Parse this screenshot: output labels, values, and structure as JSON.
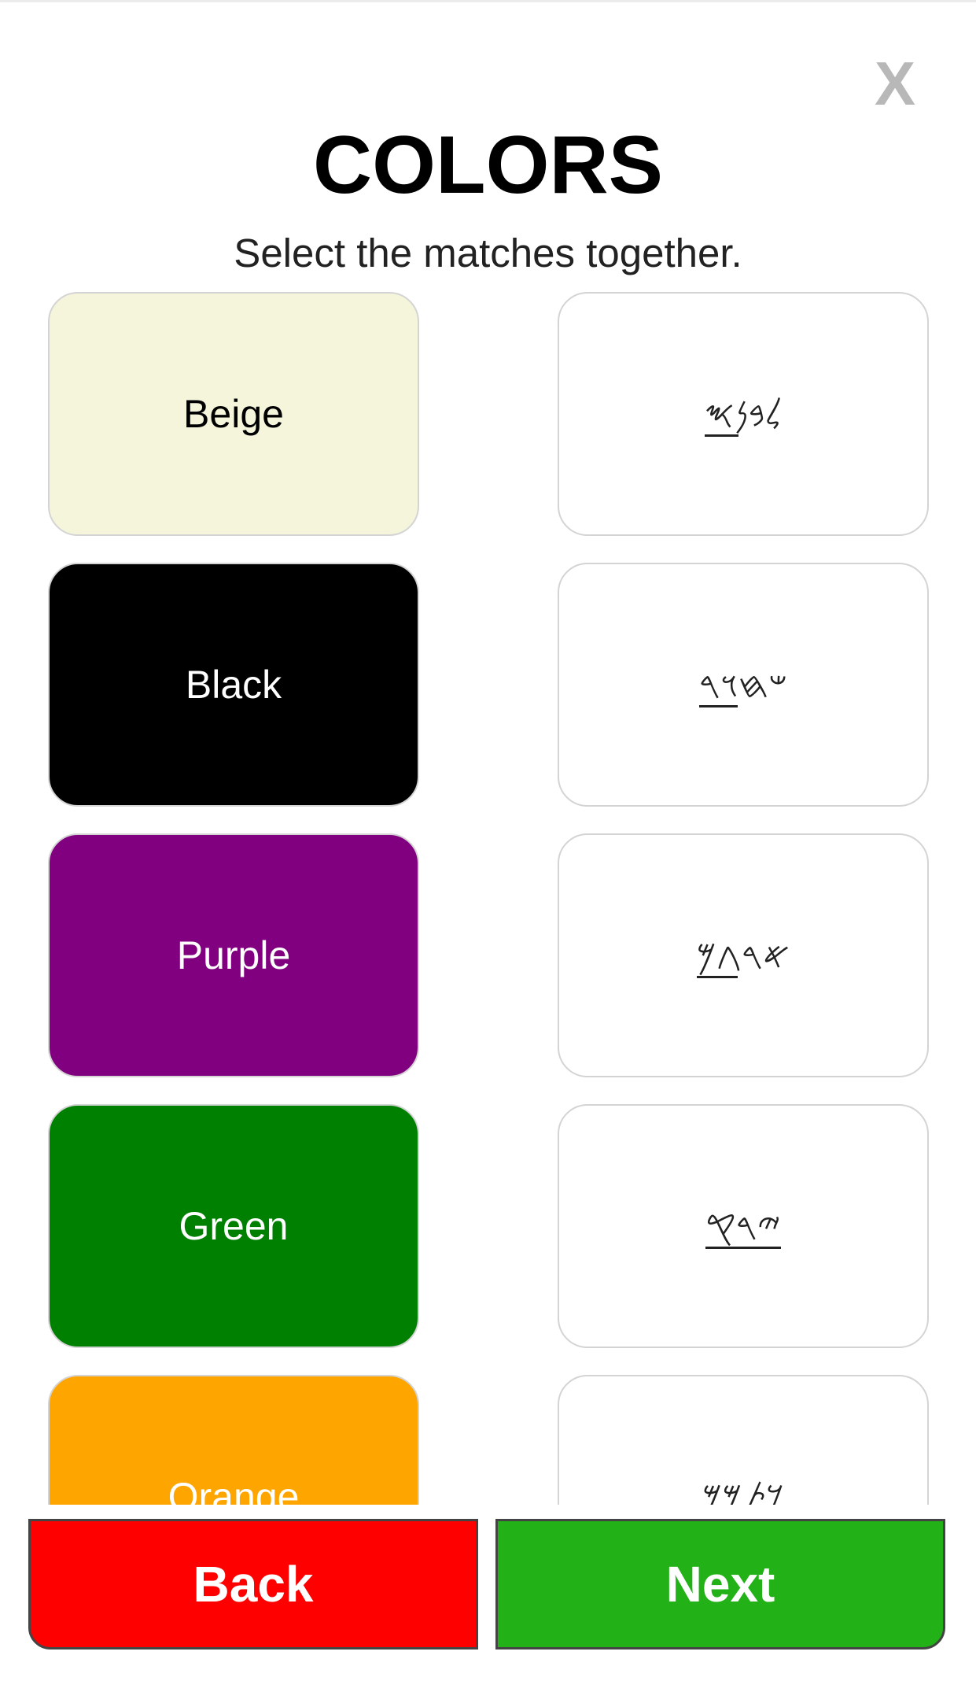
{
  "header": {
    "close_label": "X",
    "title": "COLORS",
    "subtitle": "Select the matches together."
  },
  "colors": [
    {
      "label": "Beige",
      "bg": "#F5F5DC",
      "text_color": "#000000"
    },
    {
      "label": "Black",
      "bg": "#000000",
      "text_color": "#FFFFFF"
    },
    {
      "label": "Purple",
      "bg": "#800080",
      "text_color": "#FFFFFF"
    },
    {
      "label": "Green",
      "bg": "#008000",
      "text_color": "#FFFFFF"
    },
    {
      "label": "Orange",
      "bg": "#FFA500",
      "text_color": "#FFFFFF"
    }
  ],
  "matches": [
    {
      "label": "𐤋𐤁𐤍𐤎"
    },
    {
      "label": "𐤔𐤇𐤅𐤓"
    },
    {
      "label": "𐤀𐤓𐤂𐤌"
    },
    {
      "label": "𐤉𐤓𐤒"
    },
    {
      "label": "𐤊𐤕𐤌𐤌"
    }
  ],
  "footer": {
    "back_label": "Back",
    "next_label": "Next",
    "back_color": "#FF0000",
    "next_color": "#22B117"
  }
}
